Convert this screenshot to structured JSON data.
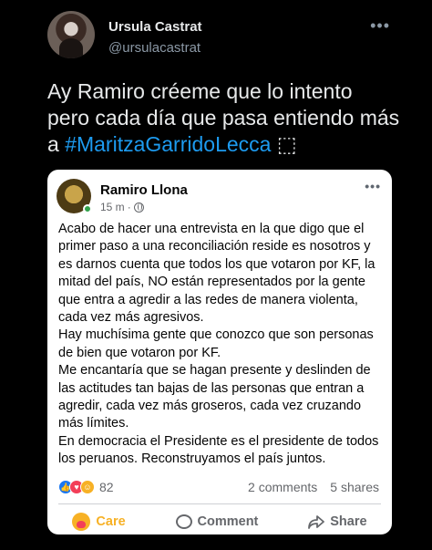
{
  "tweet": {
    "display_name": "Ursula Castrat",
    "handle": "@ursulacastrat",
    "more_icon": "more-horizontal-icon",
    "text_line1": "Ay Ramiro créeme que lo intento",
    "text_line2": "pero cada día que pasa entiendo más",
    "text_line3_prefix": "a ",
    "hashtag": "#MaritzaGarridoLecca",
    "text_line3_suffix": " ",
    "emoji_placeholder": "⬚"
  },
  "facebook_post": {
    "author": "Ramiro Llona",
    "time": "15 m",
    "separator": "·",
    "body_paragraphs": [
      "Acabo de hacer una entrevista en la que digo que el primer paso a una reconciliación reside es nosotros y es darnos cuenta que todos los que votaron por KF, la mitad del país, NO están representados por la gente que entra a agredir a las redes de manera violenta, cada vez más agresivos.",
      "Hay muchísima gente que conozco que son personas de bien que votaron por KF.",
      "Me encantaría que se hagan presente y deslinden de las actitudes tan bajas de las personas que entran a agredir, cada vez más groseros, cada vez cruzando más límites.",
      "En democracia el Presidente es el presidente de todos los peruanos. Reconstruyamos el país juntos."
    ],
    "reaction_count": "82",
    "comments": "2 comments",
    "shares": "5 shares",
    "actions": {
      "care": "Care",
      "comment": "Comment",
      "share": "Share"
    }
  },
  "colors": {
    "background": "#000000",
    "hashtag": "#1d9bf0",
    "card": "#ffffff",
    "fb_secondary": "#65676b",
    "care": "#f7b125"
  }
}
